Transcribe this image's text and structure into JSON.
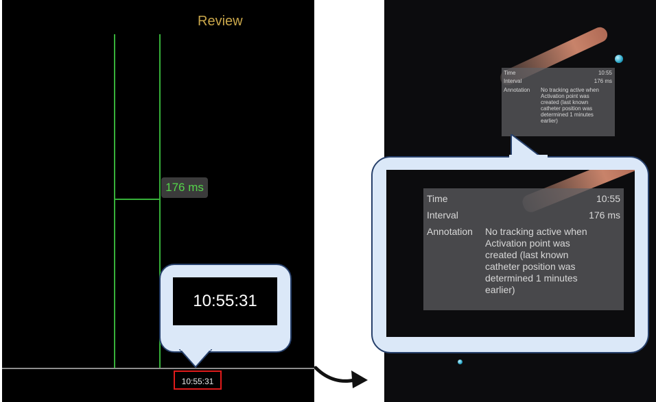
{
  "left": {
    "title": "Review",
    "interval_label": "176 ms",
    "time_marker": "10:55:31",
    "callout_time": "10:55:31"
  },
  "tooltip": {
    "time_label": "Time",
    "time_value": "10:55",
    "interval_label": "Interval",
    "interval_value": "176 ms",
    "annotation_label": "Annotation",
    "annotation_lines": [
      "No tracking active when",
      "Activation point was",
      "created (last known",
      "catheter position was",
      "determined 1 minutes",
      "earlier)"
    ]
  },
  "colors": {
    "trace_green": "#37b13a",
    "label_green": "#55d64a",
    "title_gold": "#c9a64a",
    "highlight_red": "#e11b1b",
    "callout_fill": "#dbe8f8",
    "callout_border": "#27406b"
  },
  "icons": {
    "arrow": "curved-arrow-icon",
    "marker": "catheter-dot-icon"
  }
}
